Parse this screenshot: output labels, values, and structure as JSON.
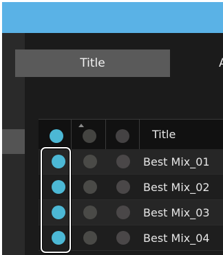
{
  "tabs": [
    {
      "label": "Title",
      "selected": true
    },
    {
      "label": "A",
      "selected": false
    }
  ],
  "list": {
    "header": {
      "title_label": "Title"
    },
    "rows": [
      {
        "title": "Best Mix_01"
      },
      {
        "title": "Best Mix_02"
      },
      {
        "title": "Best Mix_03"
      },
      {
        "title": "Best Mix_04"
      }
    ]
  },
  "colors": {
    "titlebar": "#5ab2e6",
    "accent_dot": "#4cb8d5",
    "highlight_outline": "#ffffff"
  }
}
